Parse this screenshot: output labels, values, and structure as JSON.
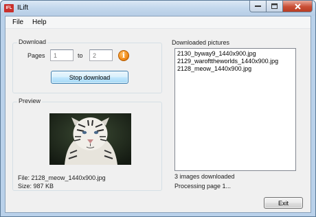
{
  "window": {
    "icon_text": "IFL",
    "title": "ILift"
  },
  "menu": {
    "file": "File",
    "help": "Help"
  },
  "download": {
    "title": "Download",
    "pages_label": "Pages",
    "from_value": "1",
    "to_label": "to",
    "to_value": "2",
    "info_glyph": "i",
    "stop_button": "Stop download"
  },
  "preview": {
    "title": "Preview",
    "file_label": "File: 2128_meow_1440x900.jpg",
    "size_label": "Size: 987 KB"
  },
  "downloaded": {
    "title": "Downloaded pictures",
    "items": [
      "2130_byway9_1440x900.jpg",
      "2129_warofttheworlds_1440x900.jpg",
      "2128_meow_1440x900.jpg"
    ],
    "count_status": "3 images downloaded",
    "progress_status": "Processing page 1..."
  },
  "exit_button": "Exit",
  "colors": {
    "accent_button_border": "#3c7fb1",
    "info_icon": "#f39020",
    "close_button": "#c94e35"
  },
  "icons": {
    "info": "info-icon",
    "app": "app-icon",
    "image": "tiger-preview-image"
  }
}
